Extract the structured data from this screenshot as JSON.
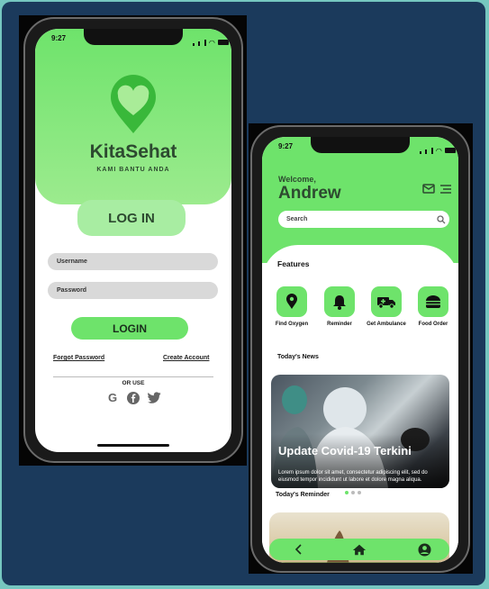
{
  "login_screen": {
    "status_time": "9:27",
    "brand": "KitaSehat",
    "tagline": "KAMI BANTU ANDA",
    "header_badge": "LOG IN",
    "username_placeholder": "Username",
    "password_placeholder": "Password",
    "login_button": "LOGIN",
    "forgot_password": "Forgot Password",
    "create_account": "Create Account",
    "or_use": "OR USE",
    "social_icons": [
      "google-icon",
      "facebook-icon",
      "twitter-icon"
    ]
  },
  "home_screen": {
    "status_time": "9:27",
    "welcome": "Welcome,",
    "username": "Andrew",
    "search_placeholder": "Search",
    "features_title": "Features",
    "features": [
      {
        "label": "Find Oxygen",
        "icon": "map-pin-icon"
      },
      {
        "label": "Reminder",
        "icon": "bell-icon"
      },
      {
        "label": "Get Ambulance",
        "icon": "ambulance-icon"
      },
      {
        "label": "Food Order",
        "icon": "burger-icon"
      }
    ],
    "news_title": "Today's News",
    "news_card": {
      "title": "Update Covid-19 Terkini",
      "body": "Lorem ipsum dolor sit amet, consectetur adipiscing elit, sed do eiusmod tempor incididunt ut labore et dolore magna aliqua."
    },
    "reminder_title": "Today's Reminder",
    "nav_icons": [
      "back-icon",
      "home-icon",
      "profile-icon"
    ]
  },
  "colors": {
    "accent": "#6ee36b",
    "accent_light": "#a8eda2",
    "background": "#1b3a5c",
    "text_dark": "#2d4a30"
  }
}
